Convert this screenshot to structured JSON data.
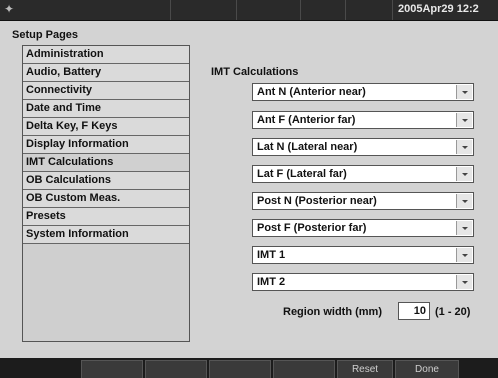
{
  "status": {
    "date_time": "2005Apr29 12:2"
  },
  "setup": {
    "title": "Setup Pages",
    "items": [
      {
        "label": "Administration"
      },
      {
        "label": "Audio, Battery"
      },
      {
        "label": "Connectivity"
      },
      {
        "label": "Date and Time"
      },
      {
        "label": "Delta Key, F Keys"
      },
      {
        "label": "Display Information"
      },
      {
        "label": "IMT Calculations"
      },
      {
        "label": "OB Calculations"
      },
      {
        "label": "OB Custom Meas."
      },
      {
        "label": "Presets"
      },
      {
        "label": "System Information"
      }
    ],
    "selected": "IMT Calculations"
  },
  "imt": {
    "title": "IMT Calculations",
    "dropdowns": [
      {
        "value": "Ant N (Anterior near)"
      },
      {
        "value": "Ant F (Anterior far)"
      },
      {
        "value": "Lat N (Lateral near)"
      },
      {
        "value": "Lat F (Lateral far)"
      },
      {
        "value": "Post N (Posterior near)"
      },
      {
        "value": "Post F (Posterior far)"
      },
      {
        "value": "IMT 1"
      },
      {
        "value": "IMT 2"
      }
    ],
    "region_width": {
      "label": "Region width (mm)",
      "value": "10",
      "range": "(1 - 20)"
    }
  },
  "softkeys": {
    "reset": "Reset",
    "done": "Done"
  },
  "colors": {
    "panel": "#d3d3d3",
    "status_bar": "#2a2a2a",
    "softkey_bar": "#1c1c1c"
  }
}
